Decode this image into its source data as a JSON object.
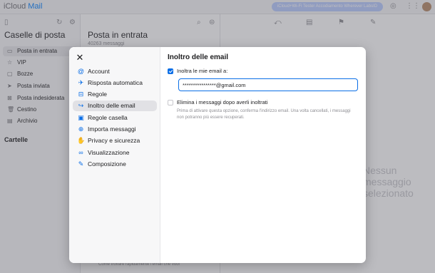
{
  "background": {
    "logo": "iCloud",
    "logo_mail": "Mail",
    "banner": "iCloud+Wi-Fi Tester Accodiamento Wherever LabsID",
    "sidebar": {
      "title": "Caselle di posta",
      "items": [
        {
          "label": "Posta in entrata",
          "icon": "inbox-icon",
          "glyph": "▭"
        },
        {
          "label": "VIP",
          "icon": "star-icon",
          "glyph": "☆"
        },
        {
          "label": "Bozze",
          "icon": "draft-icon",
          "glyph": "▢"
        },
        {
          "label": "Posta inviata",
          "icon": "sent-icon",
          "glyph": "➤"
        },
        {
          "label": "Posta indesiderata",
          "icon": "junk-icon",
          "glyph": "⊠"
        },
        {
          "label": "Cestino",
          "icon": "trash-icon",
          "glyph": "🗑"
        },
        {
          "label": "Archivio",
          "icon": "archive-icon",
          "glyph": "▤"
        }
      ],
      "section": "Cartelle"
    },
    "list": {
      "title": "Posta in entrata",
      "subtitle": "40263 messaggi",
      "footer": "Come trovare rapidamente l'email che vuoi"
    },
    "reading_empty": "Nessun messaggio selezionato"
  },
  "modal": {
    "close_glyph": "✕",
    "nav": [
      {
        "label": "Account",
        "icon": "at-icon",
        "glyph": "@",
        "active": false
      },
      {
        "label": "Risposta automatica",
        "icon": "plane-icon",
        "glyph": "✈",
        "active": false
      },
      {
        "label": "Regole",
        "icon": "rules-icon",
        "glyph": "⊟",
        "active": false
      },
      {
        "label": "Inoltro delle email",
        "icon": "forward-icon",
        "glyph": "↪",
        "active": true
      },
      {
        "label": "Regole casella",
        "icon": "mailbox-rules-icon",
        "glyph": "▣",
        "active": false
      },
      {
        "label": "Importa messaggi",
        "icon": "import-icon",
        "glyph": "⊕",
        "active": false
      },
      {
        "label": "Privacy e sicurezza",
        "icon": "hand-icon",
        "glyph": "✋",
        "active": false
      },
      {
        "label": "Visualizzazione",
        "icon": "glasses-icon",
        "glyph": "∞",
        "active": false
      },
      {
        "label": "Composizione",
        "icon": "compose-icon",
        "glyph": "✎",
        "active": false
      }
    ],
    "content": {
      "title": "Inoltro delle email",
      "forward_label": "Inoltra le mie email a:",
      "forward_checked": true,
      "email_value": "****************@gmail.com",
      "delete_label": "Elimina i messaggi dopo averli inoltrati",
      "delete_checked": false,
      "description": "Prima di attivare questa opzione, conferma l'indirizzo email. Una volta cancellati, i messaggi non potranno più essere recuperati."
    }
  },
  "colors": {
    "accent": "#0a6ee6",
    "overlay": "rgba(80,80,90,0.38)"
  }
}
